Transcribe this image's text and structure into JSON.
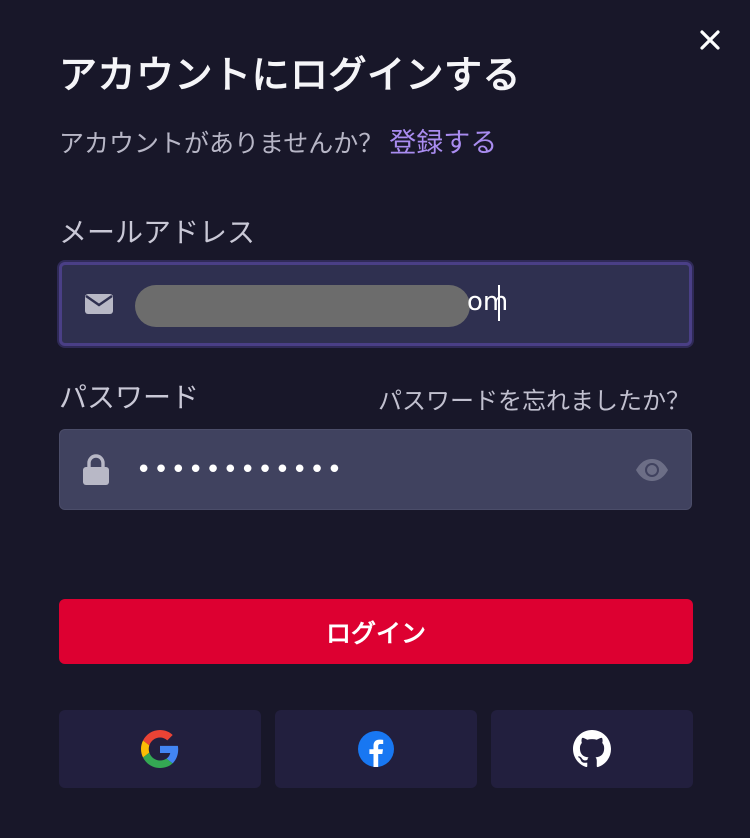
{
  "modal": {
    "title": "アカウントにログインする",
    "signup_prompt": "アカウントがありませんか？",
    "signup_link": "登録する"
  },
  "email": {
    "label": "メールアドレス",
    "value_visible_tail": "om",
    "icon": "envelope-icon"
  },
  "password": {
    "label": "パスワード",
    "forgot_link": "パスワードを忘れましたか？",
    "masked_value": "••••••••••••",
    "icon": "lock-icon",
    "toggle_icon": "eye-icon"
  },
  "login_button": {
    "label": "ログイン",
    "color": "#dd0031"
  },
  "social": [
    {
      "provider": "google",
      "icon": "google-icon"
    },
    {
      "provider": "facebook",
      "icon": "facebook-icon"
    },
    {
      "provider": "github",
      "icon": "github-icon"
    }
  ],
  "colors": {
    "background": "#181729",
    "accent_link": "#a98cf0",
    "input_bg": "#40425f",
    "focused_input_border": "#4a3f86"
  }
}
